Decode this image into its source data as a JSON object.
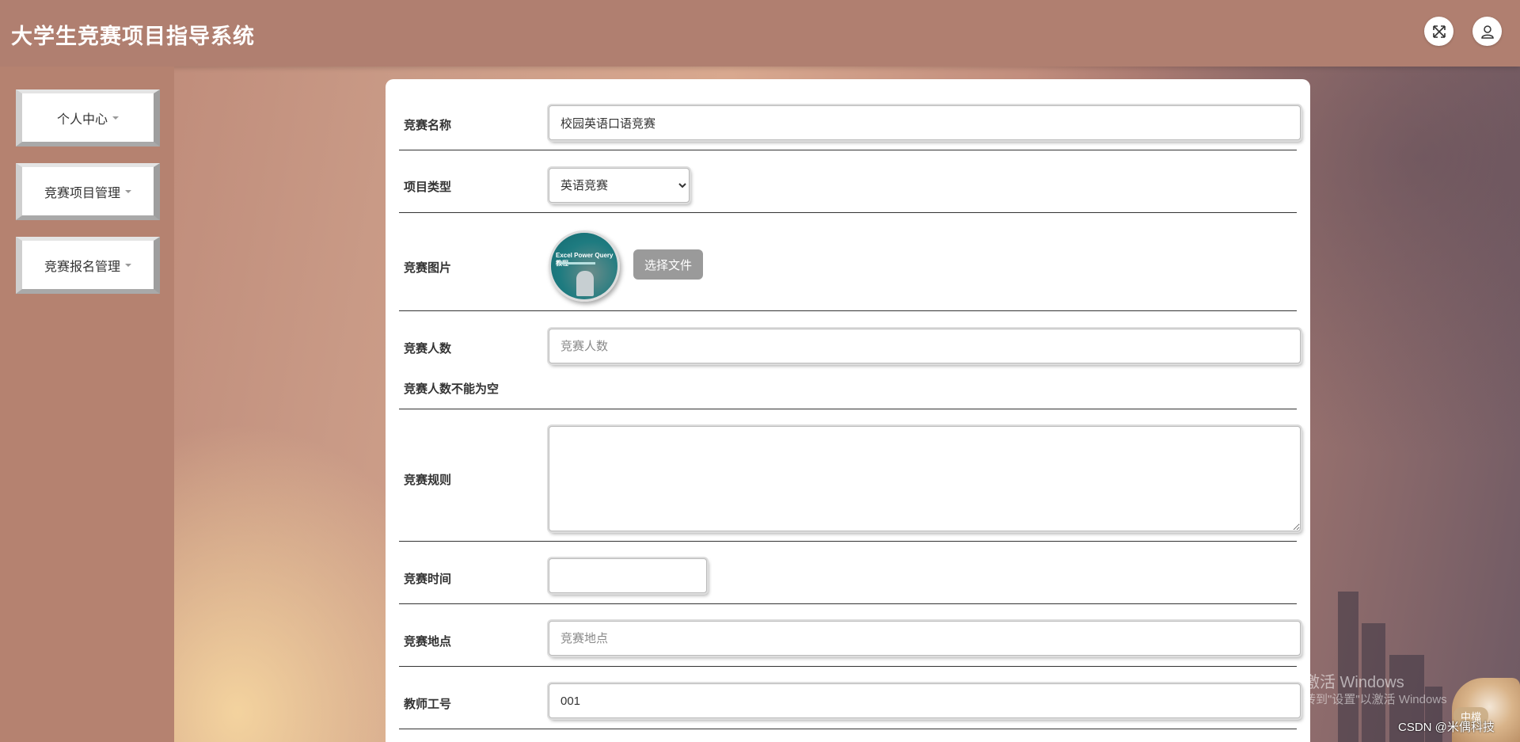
{
  "header": {
    "title": "大学生竞赛项目指导系统",
    "icons": [
      "fullscreen-icon",
      "user-icon"
    ]
  },
  "sidebar": {
    "items": [
      {
        "label": "个人中心"
      },
      {
        "label": "竞赛项目管理"
      },
      {
        "label": "竞赛报名管理"
      }
    ]
  },
  "form": {
    "competition_name": {
      "label": "竞赛名称",
      "value": "校园英语口语竞赛"
    },
    "project_type": {
      "label": "项目类型",
      "selected": "英语竞赛"
    },
    "competition_image": {
      "label": "竞赛图片",
      "button": "选择文件",
      "thumb_text": "Excel Power Query 教程"
    },
    "participants": {
      "label": "竞赛人数",
      "placeholder": "竞赛人数",
      "error": "竞赛人数不能为空"
    },
    "rules": {
      "label": "竞赛规则",
      "value": ""
    },
    "time": {
      "label": "竞赛时间",
      "value": ""
    },
    "location": {
      "label": "竞赛地点",
      "placeholder": "竞赛地点"
    },
    "teacher_id": {
      "label": "教师工号",
      "value": "001"
    }
  },
  "overlay": {
    "activate_title": "激活 Windows",
    "activate_hint": "转到\"设置\"以激活 Windows",
    "credit": "CSDN @米偶科技",
    "badge": "中檔"
  },
  "colors": {
    "header_bg": "#b07f70",
    "sidebar_bg": "#b58270",
    "upload_button": "#9a9a9a"
  }
}
